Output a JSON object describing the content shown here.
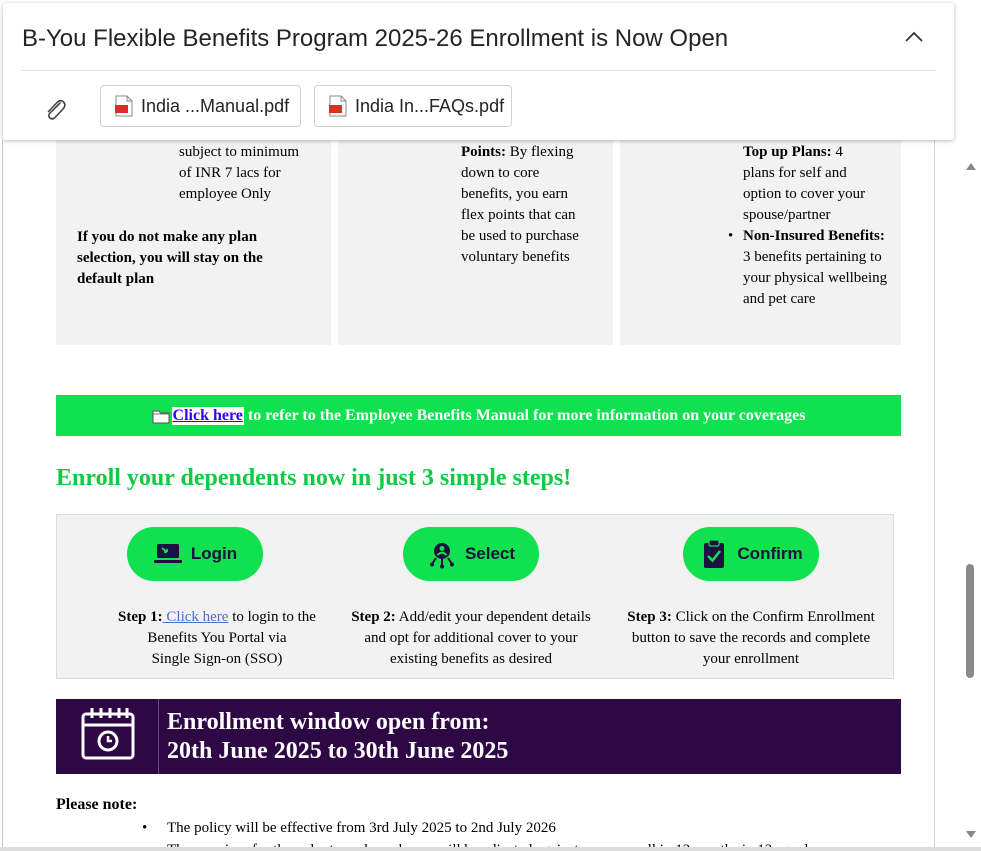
{
  "header": {
    "subject": "B-You Flexible Benefits Program 2025-26 Enrollment is Now Open",
    "attachments": [
      {
        "name": "India ...Manual.pdf",
        "icon": "pdf-icon"
      },
      {
        "name": "India In...FAQs.pdf",
        "icon": "pdf-icon"
      }
    ]
  },
  "cards": {
    "card1": {
      "lines": [
        "subject to minimum",
        "of INR 7 lacs for",
        "employee Only"
      ],
      "note": "If you do not make any plan selection, you will stay on the default plan"
    },
    "card2": {
      "cut_label": "Points:",
      "cut_text": " By flexing",
      "lines": [
        "down to core",
        "benefits, you earn",
        "flex points that can",
        "be used to purchase",
        "voluntary benefits"
      ]
    },
    "card3": {
      "cut_label": "Top up Plans:",
      "cut_text": " 4",
      "lines": [
        "plans for self and",
        "option to cover your",
        "spouse/partner"
      ],
      "bullet_label": "Non-Insured Benefits:",
      "bullet_text": " 3 benefits pertaining to your physical wellbeing and pet care"
    }
  },
  "manual_bar": {
    "link": "Click here",
    "text": " to refer to the Employee Benefits Manual for more information on your coverages"
  },
  "steps_heading": "Enroll your dependents now in just 3 simple steps!",
  "steps": [
    {
      "button": "Login",
      "label": "Step 1:",
      "link": " Click here",
      "text1": " to login to the",
      "text2": "Benefits You Portal via",
      "text3": "Single Sign-on (SSO)"
    },
    {
      "button": "Select",
      "label": "Step 2:",
      "text": " Add/edit your dependent details and opt for additional cover to your existing benefits as desired"
    },
    {
      "button": "Confirm",
      "label": "Step 3:",
      "text": " Click on the Confirm Enrollment button to save the records and complete your enrollment"
    }
  ],
  "window": {
    "line1": "Enrollment window open from:",
    "line2": "20th June 2025 to 30th June 2025"
  },
  "notes": {
    "title": "Please note:",
    "items": [
      "The policy will be effective from 3rd July 2025 to 2nd July 2026",
      "The premium for the voluntary plans chosen will be adjusted against your payroll in 12 months in 12 equal"
    ]
  },
  "colors": {
    "green": "#11e04f",
    "heading_green": "#11c943",
    "purple": "#2e0845",
    "pill_text": "#1d1042",
    "link_blue": "#3300ff"
  }
}
